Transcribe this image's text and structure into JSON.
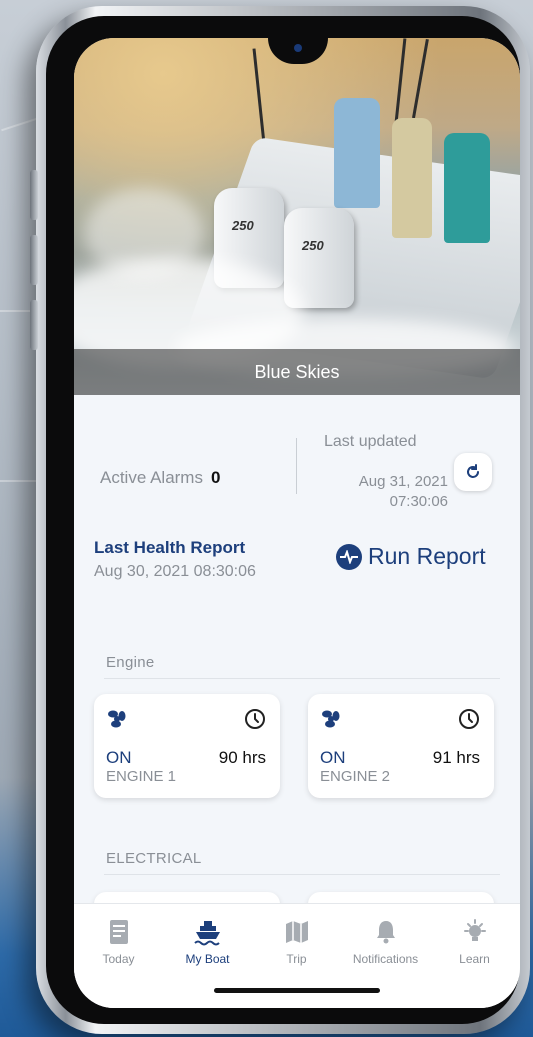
{
  "boat": {
    "name": "Blue Skies",
    "image": "boat-hero-photo",
    "engine_badge": "250"
  },
  "status": {
    "active_alarms_label": "Active Alarms",
    "active_alarms_count": "0",
    "last_updated_label": "Last updated",
    "last_updated_date": "Aug 31, 2021",
    "last_updated_time": "07:30:06",
    "refresh_icon": "refresh-icon"
  },
  "health": {
    "title": "Last Health Report",
    "date": "Aug 30, 2021 08:30:06",
    "run_report_label": "Run Report",
    "run_report_icon": "heartbeat-icon"
  },
  "sections": {
    "engine": "Engine",
    "electrical": "ELECTRICAL"
  },
  "engines": [
    {
      "state": "ON",
      "hours": "90 hrs",
      "name": "ENGINE 1"
    },
    {
      "state": "ON",
      "hours": "91 hrs",
      "name": "ENGINE 2"
    }
  ],
  "tabs": [
    {
      "label": "Today",
      "icon": "document-icon"
    },
    {
      "label": "My Boat",
      "icon": "boat-icon"
    },
    {
      "label": "Trip",
      "icon": "map-icon"
    },
    {
      "label": "Notifications",
      "icon": "bell-icon"
    },
    {
      "label": "Learn",
      "icon": "lightbulb-icon"
    }
  ],
  "active_tab": "My Boat",
  "colors": {
    "primary": "#1d3f7c",
    "muted": "#8a8f96",
    "screen_bg": "#f3f6fa",
    "card_bg": "#ffffff"
  }
}
